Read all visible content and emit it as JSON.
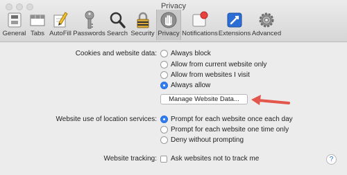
{
  "window": {
    "title": "Privacy"
  },
  "toolbar": {
    "items": [
      {
        "label": "General",
        "icon": "general-switch-icon"
      },
      {
        "label": "Tabs",
        "icon": "tabs-icon"
      },
      {
        "label": "AutoFill",
        "icon": "pencil-form-icon"
      },
      {
        "label": "Passwords",
        "icon": "key-icon"
      },
      {
        "label": "Search",
        "icon": "magnifier-icon"
      },
      {
        "label": "Security",
        "icon": "padlock-icon"
      },
      {
        "label": "Privacy",
        "icon": "hand-icon",
        "selected": true
      },
      {
        "label": "Notifications",
        "icon": "notification-badge-icon"
      },
      {
        "label": "Extensions",
        "icon": "extensions-icon"
      },
      {
        "label": "Advanced",
        "icon": "gear-icon"
      }
    ]
  },
  "cookies": {
    "label": "Cookies and website data:",
    "options": [
      "Always block",
      "Allow from current website only",
      "Allow from websites I visit",
      "Always allow"
    ],
    "selected": "Always allow",
    "manage_button": "Manage Website Data..."
  },
  "location": {
    "label": "Website use of location services:",
    "options": [
      "Prompt for each website once each day",
      "Prompt for each website one time only",
      "Deny without prompting"
    ],
    "selected": "Prompt for each website once each day"
  },
  "tracking": {
    "label": "Website tracking:",
    "checkbox_label": "Ask websites not to track me",
    "checked": false
  },
  "help": {
    "label": "?"
  },
  "colors": {
    "accent": "#2f7cf6",
    "annotation_arrow": "#e2564b",
    "notification_dot": "#e8423f"
  }
}
